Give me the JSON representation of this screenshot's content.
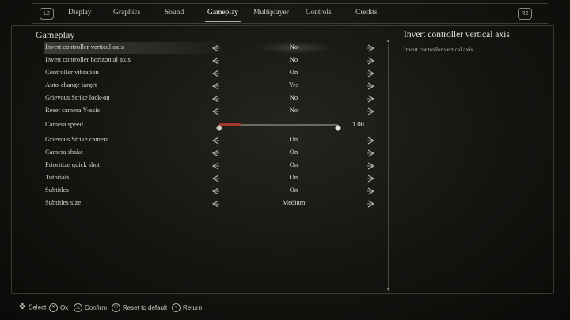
{
  "nav": {
    "left_badge": "L2",
    "right_badge": "R2",
    "tabs": [
      {
        "label": "Display"
      },
      {
        "label": "Graphics"
      },
      {
        "label": "Sound"
      },
      {
        "label": "Gameplay"
      },
      {
        "label": "Multiplayer"
      },
      {
        "label": "Controls"
      },
      {
        "label": "Credits"
      }
    ],
    "active_tab": "Gameplay"
  },
  "section_title": "Gameplay",
  "settings": [
    {
      "label": "Invert controller vertical axis",
      "value": "No"
    },
    {
      "label": "Invert controller horizontal axis",
      "value": "No"
    },
    {
      "label": "Controller vibration",
      "value": "On"
    },
    {
      "label": "Auto-change target",
      "value": "Yes"
    },
    {
      "label": "Grievous Strike lock-on",
      "value": "No"
    },
    {
      "label": "Reset camera Y-axis",
      "value": "No"
    },
    {
      "label": "Camera speed",
      "slider_value": "1.00",
      "slider_fraction": 0.18
    },
    {
      "label": "Grievous Strike camera",
      "value": "On"
    },
    {
      "label": "Camera shake",
      "value": "On"
    },
    {
      "label": "Prioritize quick shot",
      "value": "On"
    },
    {
      "label": "Tutorials",
      "value": "On"
    },
    {
      "label": "Subtitles",
      "value": "On"
    },
    {
      "label": "Subtitles size",
      "value": "Medium"
    }
  ],
  "selected_setting": "Invert controller vertical axis",
  "description": {
    "title": "Invert controller vertical axis",
    "text": "Invert controller vertical axis"
  },
  "footer": [
    {
      "icon": "dpad-icon",
      "label": "Select"
    },
    {
      "icon": "cross-button-icon",
      "label": "Ok"
    },
    {
      "icon": "triangle-button-icon",
      "label": "Confirm"
    },
    {
      "icon": "square-button-icon",
      "label": "Reset to default"
    },
    {
      "icon": "circle-button-icon",
      "label": "Return"
    }
  ],
  "colors": {
    "accent_red": "#a33a2c",
    "text": "#d8d4c8",
    "background": "#141411"
  }
}
